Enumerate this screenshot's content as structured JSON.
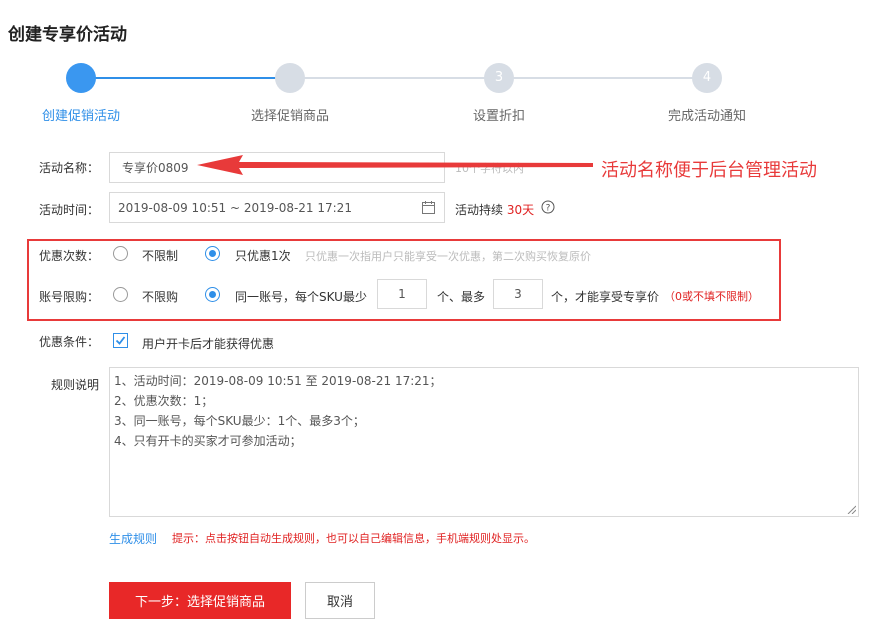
{
  "page": {
    "title": "创建专享价活动"
  },
  "steps": [
    {
      "number": "",
      "label": "创建促销活动",
      "active": true
    },
    {
      "number": "",
      "label": "选择促销商品",
      "active": false
    },
    {
      "number": "3",
      "label": "设置折扣",
      "active": false
    },
    {
      "number": "4",
      "label": "完成活动通知",
      "active": false
    }
  ],
  "colors": {
    "accent": "#2f8fe8",
    "danger": "#e82828",
    "inactive_step": "#d7dde5"
  },
  "form": {
    "name": {
      "label": "活动名称：",
      "value": "专享价0809",
      "hint": "10个字符以内"
    },
    "time": {
      "label": "活动时间：",
      "value": "2019-08-09 10:51  ~  2019-08-21 17:21",
      "duration_label": "活动持续",
      "duration_value": "30天"
    },
    "discount_times": {
      "label": "优惠次数：",
      "options": [
        {
          "label": "不限制",
          "checked": false
        },
        {
          "label": "只优惠1次",
          "checked": true
        }
      ],
      "hint": "只优惠一次指用户只能享受一次优惠，第二次购买恢复原价"
    },
    "account_limit": {
      "label": "账号限购：",
      "options": [
        {
          "label": "不限购",
          "checked": false
        },
        {
          "label": "同一账号，每个SKU最少",
          "checked": true
        }
      ],
      "min_value": "1",
      "mid_text": "个、最多",
      "max_value": "3",
      "tail_text": "个，才能享受专享价",
      "note": "（0或不填不限制）"
    },
    "condition": {
      "label": "优惠条件：",
      "checkbox_label": "用户开卡后才能获得优惠",
      "checked": true
    },
    "rules": {
      "label": "规则说明",
      "lines": [
        "1、活动时间：2019-08-09 10:51 至 2019-08-21 17:21；",
        "2、优惠次数：1；",
        "3、同一账号，每个SKU最少：1个、最多3个；",
        "4、只有开卡的买家才可参加活动；"
      ],
      "generate_link": "生成规则",
      "tip": "提示：点击按钮自动生成规则，也可以自己编辑信息，手机端规则处显示。"
    }
  },
  "buttons": {
    "next": "下一步：选择促销商品",
    "cancel": "取消"
  },
  "annotation": {
    "text": "活动名称便于后台管理活动",
    "color": "#e83a3a"
  }
}
